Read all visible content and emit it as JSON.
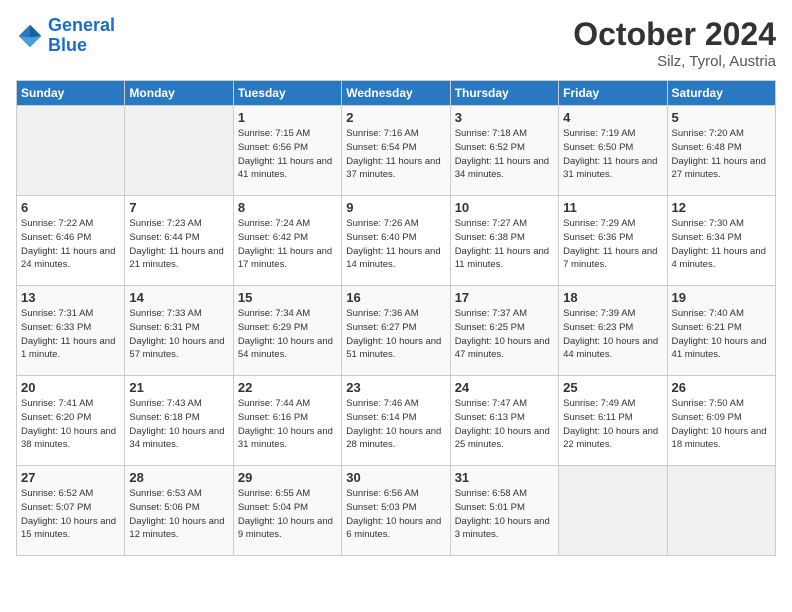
{
  "header": {
    "logo_line1": "General",
    "logo_line2": "Blue",
    "month_year": "October 2024",
    "location": "Silz, Tyrol, Austria"
  },
  "weekdays": [
    "Sunday",
    "Monday",
    "Tuesday",
    "Wednesday",
    "Thursday",
    "Friday",
    "Saturday"
  ],
  "weeks": [
    [
      {
        "day": "",
        "info": ""
      },
      {
        "day": "",
        "info": ""
      },
      {
        "day": "1",
        "info": "Sunrise: 7:15 AM\nSunset: 6:56 PM\nDaylight: 11 hours and 41 minutes."
      },
      {
        "day": "2",
        "info": "Sunrise: 7:16 AM\nSunset: 6:54 PM\nDaylight: 11 hours and 37 minutes."
      },
      {
        "day": "3",
        "info": "Sunrise: 7:18 AM\nSunset: 6:52 PM\nDaylight: 11 hours and 34 minutes."
      },
      {
        "day": "4",
        "info": "Sunrise: 7:19 AM\nSunset: 6:50 PM\nDaylight: 11 hours and 31 minutes."
      },
      {
        "day": "5",
        "info": "Sunrise: 7:20 AM\nSunset: 6:48 PM\nDaylight: 11 hours and 27 minutes."
      }
    ],
    [
      {
        "day": "6",
        "info": "Sunrise: 7:22 AM\nSunset: 6:46 PM\nDaylight: 11 hours and 24 minutes."
      },
      {
        "day": "7",
        "info": "Sunrise: 7:23 AM\nSunset: 6:44 PM\nDaylight: 11 hours and 21 minutes."
      },
      {
        "day": "8",
        "info": "Sunrise: 7:24 AM\nSunset: 6:42 PM\nDaylight: 11 hours and 17 minutes."
      },
      {
        "day": "9",
        "info": "Sunrise: 7:26 AM\nSunset: 6:40 PM\nDaylight: 11 hours and 14 minutes."
      },
      {
        "day": "10",
        "info": "Sunrise: 7:27 AM\nSunset: 6:38 PM\nDaylight: 11 hours and 11 minutes."
      },
      {
        "day": "11",
        "info": "Sunrise: 7:29 AM\nSunset: 6:36 PM\nDaylight: 11 hours and 7 minutes."
      },
      {
        "day": "12",
        "info": "Sunrise: 7:30 AM\nSunset: 6:34 PM\nDaylight: 11 hours and 4 minutes."
      }
    ],
    [
      {
        "day": "13",
        "info": "Sunrise: 7:31 AM\nSunset: 6:33 PM\nDaylight: 11 hours and 1 minute."
      },
      {
        "day": "14",
        "info": "Sunrise: 7:33 AM\nSunset: 6:31 PM\nDaylight: 10 hours and 57 minutes."
      },
      {
        "day": "15",
        "info": "Sunrise: 7:34 AM\nSunset: 6:29 PM\nDaylight: 10 hours and 54 minutes."
      },
      {
        "day": "16",
        "info": "Sunrise: 7:36 AM\nSunset: 6:27 PM\nDaylight: 10 hours and 51 minutes."
      },
      {
        "day": "17",
        "info": "Sunrise: 7:37 AM\nSunset: 6:25 PM\nDaylight: 10 hours and 47 minutes."
      },
      {
        "day": "18",
        "info": "Sunrise: 7:39 AM\nSunset: 6:23 PM\nDaylight: 10 hours and 44 minutes."
      },
      {
        "day": "19",
        "info": "Sunrise: 7:40 AM\nSunset: 6:21 PM\nDaylight: 10 hours and 41 minutes."
      }
    ],
    [
      {
        "day": "20",
        "info": "Sunrise: 7:41 AM\nSunset: 6:20 PM\nDaylight: 10 hours and 38 minutes."
      },
      {
        "day": "21",
        "info": "Sunrise: 7:43 AM\nSunset: 6:18 PM\nDaylight: 10 hours and 34 minutes."
      },
      {
        "day": "22",
        "info": "Sunrise: 7:44 AM\nSunset: 6:16 PM\nDaylight: 10 hours and 31 minutes."
      },
      {
        "day": "23",
        "info": "Sunrise: 7:46 AM\nSunset: 6:14 PM\nDaylight: 10 hours and 28 minutes."
      },
      {
        "day": "24",
        "info": "Sunrise: 7:47 AM\nSunset: 6:13 PM\nDaylight: 10 hours and 25 minutes."
      },
      {
        "day": "25",
        "info": "Sunrise: 7:49 AM\nSunset: 6:11 PM\nDaylight: 10 hours and 22 minutes."
      },
      {
        "day": "26",
        "info": "Sunrise: 7:50 AM\nSunset: 6:09 PM\nDaylight: 10 hours and 18 minutes."
      }
    ],
    [
      {
        "day": "27",
        "info": "Sunrise: 6:52 AM\nSunset: 5:07 PM\nDaylight: 10 hours and 15 minutes."
      },
      {
        "day": "28",
        "info": "Sunrise: 6:53 AM\nSunset: 5:06 PM\nDaylight: 10 hours and 12 minutes."
      },
      {
        "day": "29",
        "info": "Sunrise: 6:55 AM\nSunset: 5:04 PM\nDaylight: 10 hours and 9 minutes."
      },
      {
        "day": "30",
        "info": "Sunrise: 6:56 AM\nSunset: 5:03 PM\nDaylight: 10 hours and 6 minutes."
      },
      {
        "day": "31",
        "info": "Sunrise: 6:58 AM\nSunset: 5:01 PM\nDaylight: 10 hours and 3 minutes."
      },
      {
        "day": "",
        "info": ""
      },
      {
        "day": "",
        "info": ""
      }
    ]
  ]
}
